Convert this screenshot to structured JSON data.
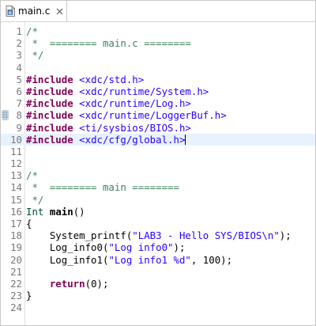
{
  "tab": {
    "label": "main.c",
    "icon": "c-source-file-icon",
    "close_icon": "close-icon"
  },
  "editor": {
    "current_line": 10,
    "marked_line": 8,
    "lines": [
      {
        "n": "1",
        "fold": "",
        "tokens": [
          {
            "c": "comment",
            "t": "/*"
          }
        ]
      },
      {
        "n": "2",
        "fold": "",
        "tokens": [
          {
            "c": "comment",
            "t": " *  ======== main.c ========"
          }
        ]
      },
      {
        "n": "3",
        "fold": "",
        "tokens": [
          {
            "c": "comment",
            "t": " */"
          }
        ]
      },
      {
        "n": "4",
        "fold": "",
        "tokens": []
      },
      {
        "n": "5",
        "fold": "",
        "tokens": [
          {
            "c": "directive",
            "t": "#include"
          },
          {
            "c": "plain",
            "t": " "
          },
          {
            "c": "header",
            "t": "<xdc/std.h>"
          }
        ]
      },
      {
        "n": "6",
        "fold": "",
        "tokens": [
          {
            "c": "directive",
            "t": "#include"
          },
          {
            "c": "plain",
            "t": " "
          },
          {
            "c": "header",
            "t": "<xdc/runtime/System.h>"
          }
        ]
      },
      {
        "n": "7",
        "fold": "",
        "tokens": [
          {
            "c": "directive",
            "t": "#include"
          },
          {
            "c": "plain",
            "t": " "
          },
          {
            "c": "header",
            "t": "<xdc/runtime/Log.h>"
          }
        ]
      },
      {
        "n": "8",
        "fold": "",
        "tokens": [
          {
            "c": "directive",
            "t": "#include"
          },
          {
            "c": "plain",
            "t": " "
          },
          {
            "c": "header",
            "t": "<xdc/runtime/LoggerBuf.h>"
          }
        ]
      },
      {
        "n": "9",
        "fold": "",
        "tokens": [
          {
            "c": "directive",
            "t": "#include"
          },
          {
            "c": "plain",
            "t": " "
          },
          {
            "c": "header",
            "t": "<ti/sysbios/BIOS.h>"
          }
        ]
      },
      {
        "n": "10",
        "fold": "",
        "tokens": [
          {
            "c": "directive",
            "t": "#include"
          },
          {
            "c": "plain",
            "t": " "
          },
          {
            "c": "header",
            "t": "<xdc/cfg/global.h>"
          }
        ],
        "caret": true
      },
      {
        "n": "11",
        "fold": "",
        "tokens": []
      },
      {
        "n": "12",
        "fold": "",
        "tokens": []
      },
      {
        "n": "13",
        "fold": "",
        "tokens": [
          {
            "c": "comment",
            "t": "/*"
          }
        ]
      },
      {
        "n": "14",
        "fold": "",
        "tokens": [
          {
            "c": "comment",
            "t": " *  ======== main ========"
          }
        ]
      },
      {
        "n": "15",
        "fold": "",
        "tokens": [
          {
            "c": "comment",
            "t": " */"
          }
        ]
      },
      {
        "n": "16",
        "fold": "",
        "tokens": [
          {
            "c": "type",
            "t": "Int"
          },
          {
            "c": "plain",
            "t": " "
          },
          {
            "c": "func",
            "t": "main"
          },
          {
            "c": "plain",
            "t": "()"
          }
        ]
      },
      {
        "n": "17",
        "fold": "",
        "tokens": [
          {
            "c": "plain",
            "t": "{"
          }
        ]
      },
      {
        "n": "18",
        "fold": "",
        "tokens": [
          {
            "c": "plain",
            "t": "    System_printf("
          },
          {
            "c": "string",
            "t": "\"LAB3 - Hello SYS/BIOS\\n\""
          },
          {
            "c": "plain",
            "t": ");"
          }
        ]
      },
      {
        "n": "19",
        "fold": "",
        "tokens": [
          {
            "c": "plain",
            "t": "    Log_info0("
          },
          {
            "c": "string",
            "t": "\"Log info0\""
          },
          {
            "c": "plain",
            "t": ");"
          }
        ]
      },
      {
        "n": "20",
        "fold": "",
        "tokens": [
          {
            "c": "plain",
            "t": "    Log_info1("
          },
          {
            "c": "string",
            "t": "\"Log info1 %d\""
          },
          {
            "c": "plain",
            "t": ", 100);"
          }
        ]
      },
      {
        "n": "21",
        "fold": "",
        "tokens": []
      },
      {
        "n": "22",
        "fold": "",
        "tokens": [
          {
            "c": "plain",
            "t": "    "
          },
          {
            "c": "keyword",
            "t": "return"
          },
          {
            "c": "plain",
            "t": "(0);"
          }
        ]
      },
      {
        "n": "23",
        "fold": "",
        "tokens": [
          {
            "c": "plain",
            "t": "}"
          }
        ]
      },
      {
        "n": "24",
        "fold": "",
        "tokens": []
      }
    ]
  },
  "colors": {
    "comment": "#3f7f5f",
    "keyword": "#7f0055",
    "string": "#2a00ff",
    "current_line_bg": "#e8f2fe",
    "line_number": "#787878"
  }
}
